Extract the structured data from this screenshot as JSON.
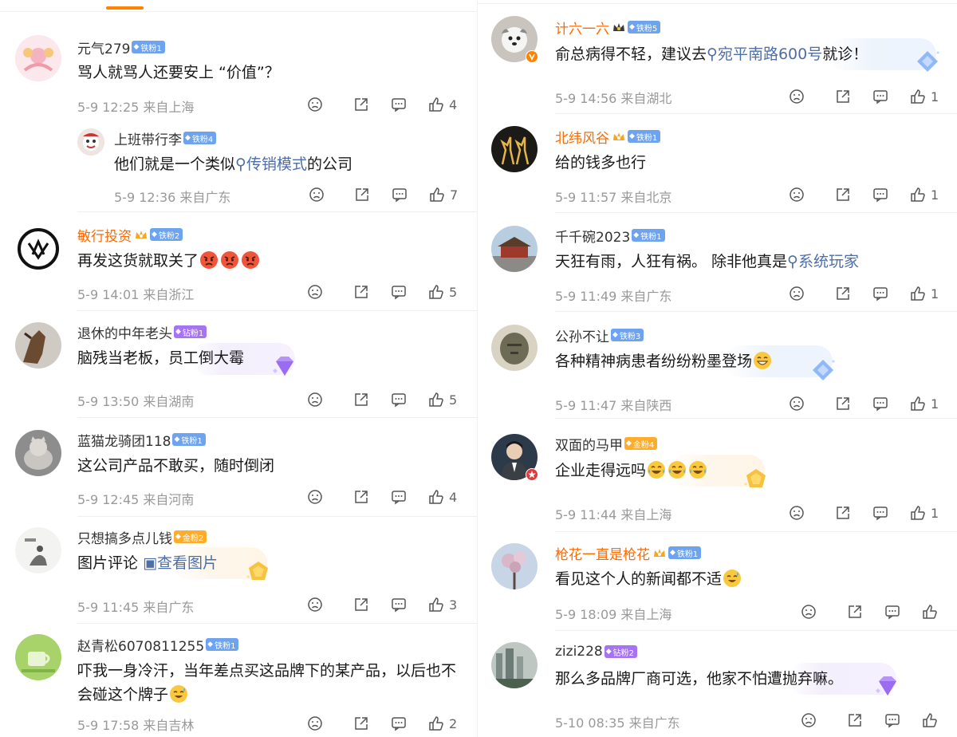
{
  "left": {
    "comments": [
      {
        "name": "元气279",
        "name_style": "normal",
        "fan": {
          "type": "iron",
          "label": "铁粉1"
        },
        "text": "骂人就骂人还要安上 “价值”？",
        "time": "5-9 12:25",
        "loc": "来自上海",
        "likes": "4",
        "avatar": "avatar-pink-floral",
        "reply": {
          "name": "上班带行李",
          "fan": {
            "type": "iron",
            "label": "铁粉4"
          },
          "text_before": "他们就是一个类似",
          "keyword": "传销模式",
          "text_after": "的公司",
          "time": "5-9 12:36",
          "loc": "来自广东",
          "likes": "7",
          "avatar": "avatar-cartoon-face"
        }
      },
      {
        "name": "敏行投资",
        "name_style": "orange",
        "fan": {
          "type": "iron",
          "label": "铁粉2"
        },
        "text": "再发这货就取关了",
        "emoji": [
          "angry-face-emoji",
          "angry-face-emoji",
          "angry-face-emoji"
        ],
        "time": "5-9 14:01",
        "loc": "来自浙江",
        "likes": "5",
        "avatar": "avatar-black-logo"
      },
      {
        "name": "退休的中年老头",
        "name_style": "normal",
        "fan": {
          "type": "drill",
          "label": "钻粉1"
        },
        "text": "脑残当老板，员工倒大霉",
        "time": "5-9 13:50",
        "loc": "来自湖南",
        "likes": "5",
        "avatar": "avatar-horse"
      },
      {
        "name": "蓝猫龙骑团118",
        "name_style": "normal",
        "fan": {
          "type": "iron",
          "label": "铁粉1"
        },
        "text": "这公司产品不敢买，随时倒闭",
        "time": "5-9 12:45",
        "loc": "来自河南",
        "likes": "4",
        "avatar": "avatar-cat"
      },
      {
        "name": "只想搞多点儿钱",
        "name_style": "normal",
        "fan": {
          "type": "gold",
          "label": "金粉2"
        },
        "text": "图片评论",
        "link": "查看图片",
        "time": "5-9 11:45",
        "loc": "来自广东",
        "likes": "3",
        "avatar": "avatar-ink-art"
      },
      {
        "name": "赵青松6070811255",
        "name_style": "normal",
        "fan": {
          "type": "iron",
          "label": "铁粉1"
        },
        "text": "吓我一身冷汗，当年差点买这品牌下的某产品，以后也不会碰这个牌子",
        "time": "5-9 17:58",
        "loc": "来自吉林",
        "likes": "2",
        "avatar": "avatar-green-cup"
      }
    ]
  },
  "right": {
    "comments": [
      {
        "name": "计六一六",
        "name_style": "orange",
        "fan": {
          "type": "iron",
          "label": "铁粉5"
        },
        "text_before": "俞总病得不轻，建议去",
        "keyword": "宛平南路600号",
        "text_after": "就诊！",
        "time": "5-9 14:56",
        "loc": "来自湖北",
        "likes": "1",
        "avatar": "avatar-puppy"
      },
      {
        "name": "北纬风谷",
        "name_style": "orange",
        "fan": {
          "type": "iron",
          "label": "铁粉1"
        },
        "text": "给的钱多也行",
        "time": "5-9 11:57",
        "loc": "来自北京",
        "likes": "1",
        "avatar": "avatar-deer"
      },
      {
        "name": "千千碗2023",
        "name_style": "normal",
        "fan": {
          "type": "iron",
          "label": "铁粉1"
        },
        "text_before": "天狂有雨，人狂有祸。 除非他真是",
        "keyword": "系统玩家",
        "text_after": "",
        "time": "5-9 11:49",
        "loc": "来自广东",
        "likes": "1",
        "avatar": "avatar-palace"
      },
      {
        "name": "公孙不让",
        "name_style": "normal",
        "fan": {
          "type": "iron",
          "label": "铁粉3"
        },
        "text": "各种精神病患者纷纷粉墨登场",
        "emoji": [
          "grin-face-emoji"
        ],
        "time": "5-9 11:47",
        "loc": "来自陕西",
        "likes": "1",
        "avatar": "avatar-sphinx"
      },
      {
        "name": "双面的马甲",
        "name_style": "normal",
        "fan": {
          "type": "gold",
          "label": "金粉4"
        },
        "text": "企业走得远吗",
        "emoji": [
          "laugh-cry-emoji",
          "laugh-cry-emoji",
          "laugh-cry-emoji"
        ],
        "time": "5-9 11:44",
        "loc": "来自上海",
        "likes": "1",
        "avatar": "avatar-man-suit"
      },
      {
        "name": "枪花一直是枪花",
        "name_style": "orange",
        "fan": {
          "type": "iron",
          "label": "铁粉1"
        },
        "text": "看见这个人的新闻都不适",
        "emoji": [
          "sweat-laugh-emoji"
        ],
        "time": "5-9 18:09",
        "loc": "来自上海",
        "likes": "",
        "avatar": "avatar-tree"
      },
      {
        "name": "zizi228",
        "name_style": "normal",
        "fan": {
          "type": "drill",
          "label": "钻粉2"
        },
        "text": "那么多品牌厂商可选，他家不怕遭抛弃嘛。",
        "time": "5-10 08:35",
        "loc": "来自广东",
        "likes": "",
        "avatar": "avatar-city"
      }
    ]
  },
  "colors": {
    "accent": "#ff8200",
    "name_orange": "#ff6a00",
    "keyword_blue": "#4e6ea8",
    "meta_gray": "#999999",
    "iron_fan": "#6ea3ef",
    "drill_fan": "#a674f2",
    "gold_fan": "#ffac2b"
  },
  "icons": [
    "dislike-icon",
    "share-icon",
    "comment-icon",
    "like-icon",
    "search-icon",
    "image-icon",
    "crown-icon",
    "gem-icon"
  ]
}
